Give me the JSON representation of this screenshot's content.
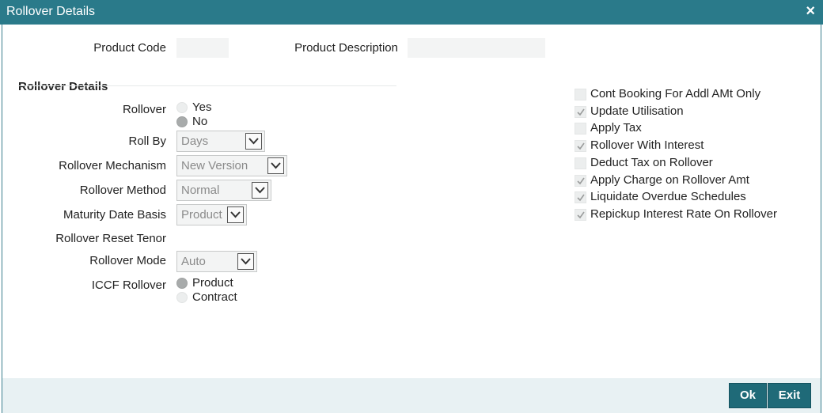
{
  "window": {
    "title": "Rollover Details",
    "close_icon": "×"
  },
  "header": {
    "product_code_label": "Product Code",
    "product_code_value": "",
    "product_description_label": "Product Description",
    "product_description_value": ""
  },
  "section": {
    "title": "Rollover Details"
  },
  "rollover": {
    "label": "Rollover",
    "options": [
      "Yes",
      "No"
    ],
    "selected": "No"
  },
  "roll_by": {
    "label": "Roll By",
    "value": "Days"
  },
  "rollover_mechanism": {
    "label": "Rollover Mechanism",
    "value": "New Version"
  },
  "rollover_method": {
    "label": "Rollover Method",
    "value": "Normal"
  },
  "maturity_date_basis": {
    "label": "Maturity Date Basis",
    "value": "Product"
  },
  "rollover_reset_tenor": {
    "label": "Rollover Reset Tenor",
    "value": ""
  },
  "rollover_mode": {
    "label": "Rollover Mode",
    "value": "Auto"
  },
  "iccf_rollover": {
    "label": "ICCF Rollover",
    "options": [
      "Product",
      "Contract"
    ],
    "selected": "Product"
  },
  "checkboxes": [
    {
      "label": "Cont Booking For Addl AMt Only",
      "checked": false
    },
    {
      "label": "Update Utilisation",
      "checked": true
    },
    {
      "label": "Apply Tax",
      "checked": false
    },
    {
      "label": "Rollover With Interest",
      "checked": true
    },
    {
      "label": "Deduct Tax on Rollover",
      "checked": false
    },
    {
      "label": "Apply Charge on Rollover Amt",
      "checked": true
    },
    {
      "label": "Liquidate Overdue Schedules",
      "checked": true
    },
    {
      "label": "Repickup Interest Rate On Rollover",
      "checked": true
    }
  ],
  "footer": {
    "ok_label": "Ok",
    "exit_label": "Exit"
  },
  "colors": {
    "titlebar": "#2a7a8a",
    "button": "#1f6a78",
    "footer": "#e8f1f3"
  }
}
